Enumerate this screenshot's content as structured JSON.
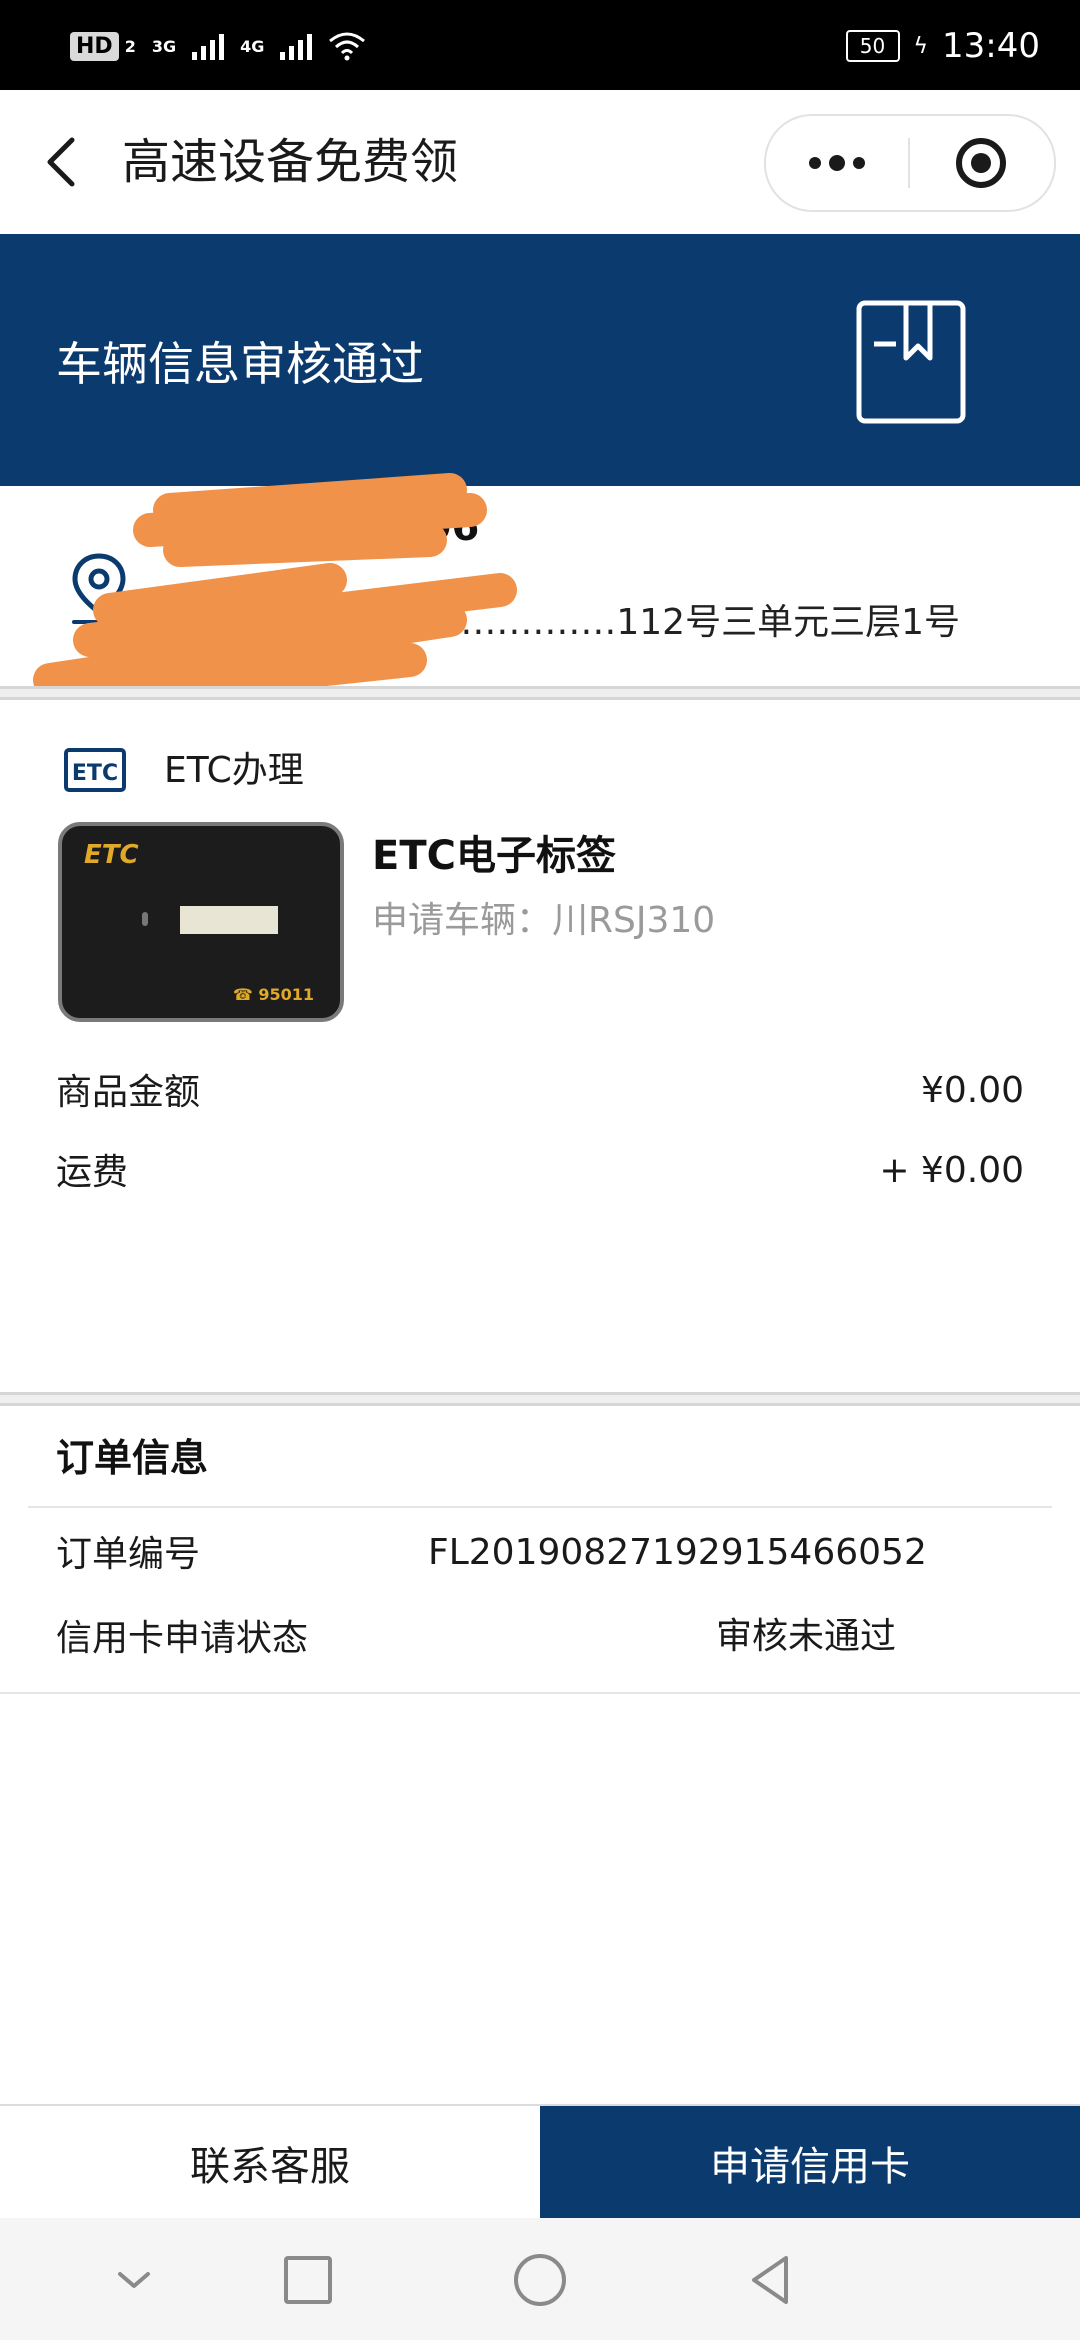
{
  "status_bar": {
    "hd_label": "HD",
    "sim_label": "2",
    "net1": "3G",
    "net2": "4G",
    "battery": "50",
    "time": "13:40"
  },
  "title_bar": {
    "title": "高速设备免费领"
  },
  "banner": {
    "title": "车辆信息审核通过"
  },
  "address": {
    "name": "…………0306",
    "detail": "……………112号三单元三层1号"
  },
  "product": {
    "section_label": "ETC办理",
    "image_logo": "ETC",
    "image_phone": "☎ 95011",
    "name": "ETC电子标签",
    "vehicle": "申请车辆：川RSJ310",
    "amount_label": "商品金额",
    "amount_value": "¥0.00",
    "shipping_label": "运费",
    "shipping_value": "+ ¥0.00"
  },
  "order": {
    "title": "订单信息",
    "order_no_label": "订单编号",
    "order_no_value": "FL2019082719291546605­2",
    "credit_label": "信用卡申请状态",
    "credit_value": "审核未通过"
  },
  "actions": {
    "contact": "联系客服",
    "apply": "申请信用卡"
  },
  "colors": {
    "brand_blue": "#0b3a6e",
    "redaction": "#f0924a"
  }
}
